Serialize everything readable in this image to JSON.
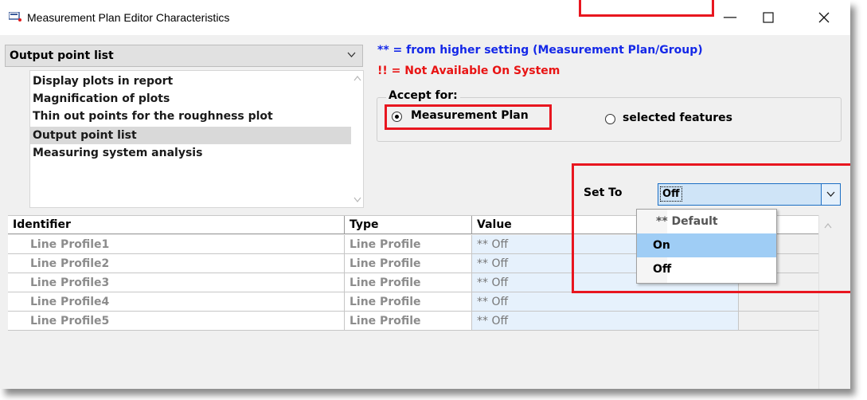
{
  "window": {
    "title": "Measurement Plan Editor Characteristics"
  },
  "characteristic_combo": {
    "selected": "Output point list"
  },
  "characteristic_list": {
    "items": [
      "Display plots in report",
      "Magnification of plots",
      "Thin out points for the roughness plot",
      "Output point list",
      "Measuring system analysis"
    ],
    "selected_index": 3
  },
  "notes": {
    "inherited": "** = from higher setting (Measurement Plan/Group)",
    "unavailable": "!! = Not Available On System"
  },
  "accept_for": {
    "label": "Accept for:",
    "options": [
      "Measurement Plan",
      "selected features"
    ],
    "selected": "Measurement Plan"
  },
  "set_to": {
    "label": "Set To",
    "value": "Off",
    "dropdown_options": [
      "** Default",
      "On",
      "Off"
    ],
    "highlighted": "On"
  },
  "grid": {
    "columns": [
      "Identifier",
      "Type",
      "Value"
    ],
    "rows": [
      {
        "identifier": "Line Profile1",
        "type": "Line Profile",
        "value": "** Off"
      },
      {
        "identifier": "Line Profile2",
        "type": "Line Profile",
        "value": "** Off"
      },
      {
        "identifier": "Line Profile3",
        "type": "Line Profile",
        "value": "** Off"
      },
      {
        "identifier": "Line Profile4",
        "type": "Line Profile",
        "value": "** Off"
      },
      {
        "identifier": "Line Profile5",
        "type": "Line Profile",
        "value": "** Off"
      }
    ]
  },
  "colors": {
    "annotation_red": "#e8161f",
    "note_blue": "#1428e8",
    "note_red": "#e81414",
    "dropdown_highlight": "#9fcdf5"
  }
}
